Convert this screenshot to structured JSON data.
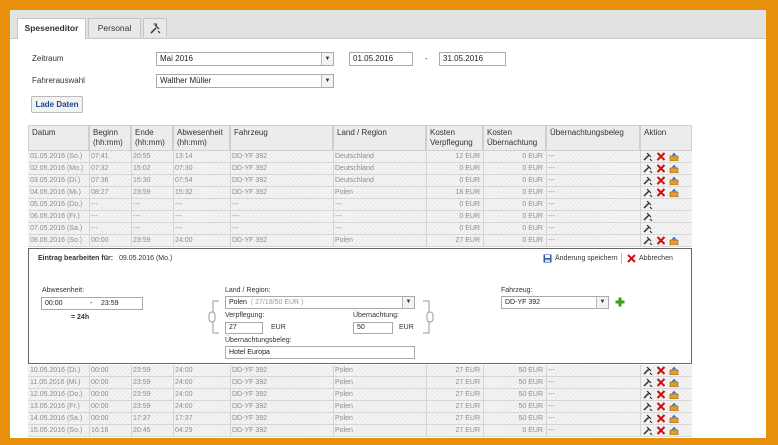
{
  "tabs": [
    {
      "label": "Speseneditor"
    },
    {
      "label": "Personal"
    },
    {
      "icon": "tools-icon"
    }
  ],
  "filter": {
    "zeitraum_label": "Zeitraum",
    "zeitraum_value": "Mai 2016",
    "date_from": "01.05.2016",
    "date_separator": "-",
    "date_to": "31.05.2016",
    "fahrer_label": "Fahrerauswahl",
    "fahrer_value": "Walther Müller",
    "load_button": "Lade Daten"
  },
  "table": {
    "headers": [
      {
        "l1": "Datum",
        "l2": ""
      },
      {
        "l1": "Beginn",
        "l2": "(hh:mm)"
      },
      {
        "l1": "Ende",
        "l2": "(hh:mm)"
      },
      {
        "l1": "Abwesenheit",
        "l2": "(hh:mm)"
      },
      {
        "l1": "Fahrzeug",
        "l2": ""
      },
      {
        "l1": "Land / Region",
        "l2": ""
      },
      {
        "l1": "Kosten",
        "l2": "Verpflegung"
      },
      {
        "l1": "Kosten",
        "l2": "Übernachtung"
      },
      {
        "l1": "Übernachtungsbeleg",
        "l2": ""
      },
      {
        "l1": "Aktion",
        "l2": ""
      }
    ],
    "rows_top": [
      {
        "d": "01.05.2016 (So.)",
        "b": "07:41",
        "e": "20:55",
        "a": "13:14",
        "f": "DD-YF 392",
        "l": "Deutschland",
        "kv": "12 EUR",
        "ku": "0 EUR",
        "u": "---",
        "actions": "full"
      },
      {
        "d": "02.05.2016 (Mo.)",
        "b": "07:32",
        "e": "15:02",
        "a": "07:30",
        "f": "DD-YF 392",
        "l": "Deutschland",
        "kv": "0 EUR",
        "ku": "0 EUR",
        "u": "---",
        "actions": "full"
      },
      {
        "d": "03.05.2016 (Di.)",
        "b": "07:36",
        "e": "15:30",
        "a": "07:54",
        "f": "DD-YF 392",
        "l": "Deutschland",
        "kv": "0 EUR",
        "ku": "0 EUR",
        "u": "---",
        "actions": "full"
      },
      {
        "d": "04.05.2016 (Mi.)",
        "b": "08:27",
        "e": "23:59",
        "a": "15:32",
        "f": "DD-YF 392",
        "l": "Polen",
        "kv": "18 EUR",
        "ku": "0 EUR",
        "u": "---",
        "actions": "full"
      },
      {
        "d": "05.05.2016 (Do.)",
        "b": "---",
        "e": "---",
        "a": "---",
        "f": "---",
        "l": "---",
        "kv": "0 EUR",
        "ku": "0 EUR",
        "u": "---",
        "actions": "edit"
      },
      {
        "d": "06.05.2016 (Fr.)",
        "b": "---",
        "e": "---",
        "a": "---",
        "f": "---",
        "l": "---",
        "kv": "0 EUR",
        "ku": "0 EUR",
        "u": "---",
        "actions": "edit"
      },
      {
        "d": "07.05.2016 (Sa.)",
        "b": "---",
        "e": "---",
        "a": "---",
        "f": "---",
        "l": "---",
        "kv": "0 EUR",
        "ku": "0 EUR",
        "u": "---",
        "actions": "edit"
      },
      {
        "d": "08.05.2016 (So.)",
        "b": "00:00",
        "e": "23:59",
        "a": "24:00",
        "f": "DD-YF 392",
        "l": "Polen",
        "kv": "27 EUR",
        "ku": "0 EUR",
        "u": "---",
        "actions": "full"
      }
    ],
    "rows_bottom": [
      {
        "d": "10.05.2016 (Di.)",
        "b": "00:00",
        "e": "23:59",
        "a": "24:00",
        "f": "DD-YF 392",
        "l": "Polen",
        "kv": "27 EUR",
        "ku": "50 EUR",
        "u": "---",
        "actions": "full"
      },
      {
        "d": "11.05.2016 (Mi.)",
        "b": "00:00",
        "e": "23:59",
        "a": "24:00",
        "f": "DD-YF 392",
        "l": "Polen",
        "kv": "27 EUR",
        "ku": "50 EUR",
        "u": "---",
        "actions": "full"
      },
      {
        "d": "12.05.2016 (Do.)",
        "b": "00:00",
        "e": "23:59",
        "a": "24:00",
        "f": "DD-YF 392",
        "l": "Polen",
        "kv": "27 EUR",
        "ku": "50 EUR",
        "u": "---",
        "actions": "full"
      },
      {
        "d": "13.05.2016 (Fr.)",
        "b": "00:00",
        "e": "23:59",
        "a": "24:00",
        "f": "DD-YF 392",
        "l": "Polen",
        "kv": "27 EUR",
        "ku": "50 EUR",
        "u": "---",
        "actions": "full"
      },
      {
        "d": "14.05.2016 (Sa.)",
        "b": "00:00",
        "e": "17:37",
        "a": "17:37",
        "f": "DD-YF 392",
        "l": "Polen",
        "kv": "27 EUR",
        "ku": "50 EUR",
        "u": "---",
        "actions": "full"
      },
      {
        "d": "15.05.2016 (So.)",
        "b": "16:16",
        "e": "20:45",
        "a": "04:29",
        "f": "DD-YF 392",
        "l": "Polen",
        "kv": "27 EUR",
        "ku": "0 EUR",
        "u": "---",
        "actions": "full"
      }
    ]
  },
  "edit": {
    "title_label": "Eintrag bearbeiten für:",
    "title_date": "09.05.2016 (Mo.)",
    "save_label": "Änderung speichern",
    "cancel_label": "Abbrechen",
    "abwesenheit_label": "Abwesenheit:",
    "time_from": "00:00",
    "time_sep": "-",
    "time_to": "23:59",
    "total": "= 24h",
    "land_label": "Land / Region:",
    "land_value": "Polen",
    "land_rates": "( 27/18/50 EUR )",
    "verpflegung_label": "Verpflegung:",
    "verpflegung_value": "27",
    "verpflegung_unit": "EUR",
    "uebernachtung_label": "Übernachtung:",
    "uebernachtung_value": "50",
    "uebernachtung_unit": "EUR",
    "beleg_label": "Übernachtungsbeleg:",
    "beleg_value": "Hotel Europa",
    "fahrzeug_label": "Fahrzeug:",
    "fahrzeug_value": "DD-YF 392"
  },
  "colors": {
    "frame": "#e8900c",
    "delete": "#cc1111",
    "save": "#2a5aa8",
    "add": "#3aa11a"
  }
}
